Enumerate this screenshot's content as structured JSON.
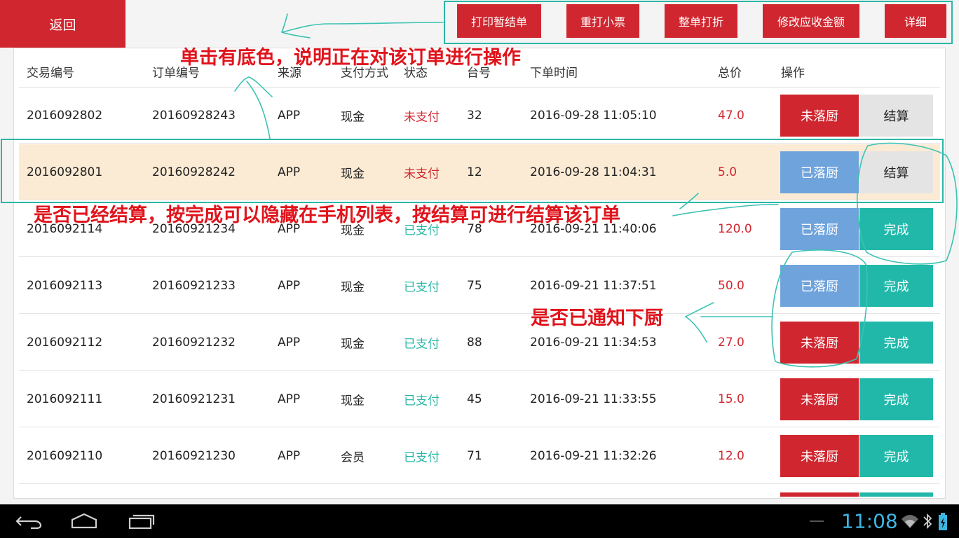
{
  "back_label": "返回",
  "toolbar": {
    "print_temp": "打印暂结单",
    "reprint": "重打小票",
    "discount": "整单打折",
    "modify_amount": "修改应收金额",
    "details": "详细"
  },
  "columns": {
    "trade_no": "交易编号",
    "order_no": "订单编号",
    "source": "来源",
    "payment": "支付方式",
    "status": "状态",
    "table": "台号",
    "time": "下单时间",
    "total": "总价",
    "action": "操作"
  },
  "rows": [
    {
      "trade_no": "2016092802",
      "order_no": "20160928243",
      "source": "APP",
      "payment": "现金",
      "status": "未支付",
      "table": "32",
      "time": "2016-09-28 11:05:10",
      "total": "47.0",
      "kitchen": "未落厨",
      "action": "结算"
    },
    {
      "trade_no": "2016092801",
      "order_no": "20160928242",
      "source": "APP",
      "payment": "现金",
      "status": "未支付",
      "table": "12",
      "time": "2016-09-28 11:04:31",
      "total": "5.0",
      "kitchen": "已落厨",
      "action": "结算"
    },
    {
      "trade_no": "2016092114",
      "order_no": "20160921234",
      "source": "APP",
      "payment": "现金",
      "status": "已支付",
      "table": "78",
      "time": "2016-09-21 11:40:06",
      "total": "120.0",
      "kitchen": "已落厨",
      "action": "完成"
    },
    {
      "trade_no": "2016092113",
      "order_no": "20160921233",
      "source": "APP",
      "payment": "现金",
      "status": "已支付",
      "table": "75",
      "time": "2016-09-21 11:37:51",
      "total": "50.0",
      "kitchen": "已落厨",
      "action": "完成"
    },
    {
      "trade_no": "2016092112",
      "order_no": "20160921232",
      "source": "APP",
      "payment": "现金",
      "status": "已支付",
      "table": "88",
      "time": "2016-09-21 11:34:53",
      "total": "27.0",
      "kitchen": "未落厨",
      "action": "完成"
    },
    {
      "trade_no": "2016092111",
      "order_no": "20160921231",
      "source": "APP",
      "payment": "现金",
      "status": "已支付",
      "table": "45",
      "time": "2016-09-21 11:33:55",
      "total": "15.0",
      "kitchen": "未落厨",
      "action": "完成"
    },
    {
      "trade_no": "2016092110",
      "order_no": "20160921230",
      "source": "APP",
      "payment": "会员",
      "status": "已支付",
      "table": "71",
      "time": "2016-09-21 11:32:26",
      "total": "12.0",
      "kitchen": "未落厨",
      "action": "完成"
    }
  ],
  "annotations": {
    "top": "单击有底色，说明正在对该订单进行操作",
    "middle": "是否已经结算，按完成可以隐藏在手机列表，按结算可进行结算该订单",
    "kitchen": "是否已通知下厨"
  },
  "status_bar": {
    "time": "11:08"
  },
  "colors": {
    "accent_red": "#d0262f",
    "teal": "#21b8aa",
    "blue": "#6fa3dc",
    "selected_row": "#fcebd4"
  }
}
